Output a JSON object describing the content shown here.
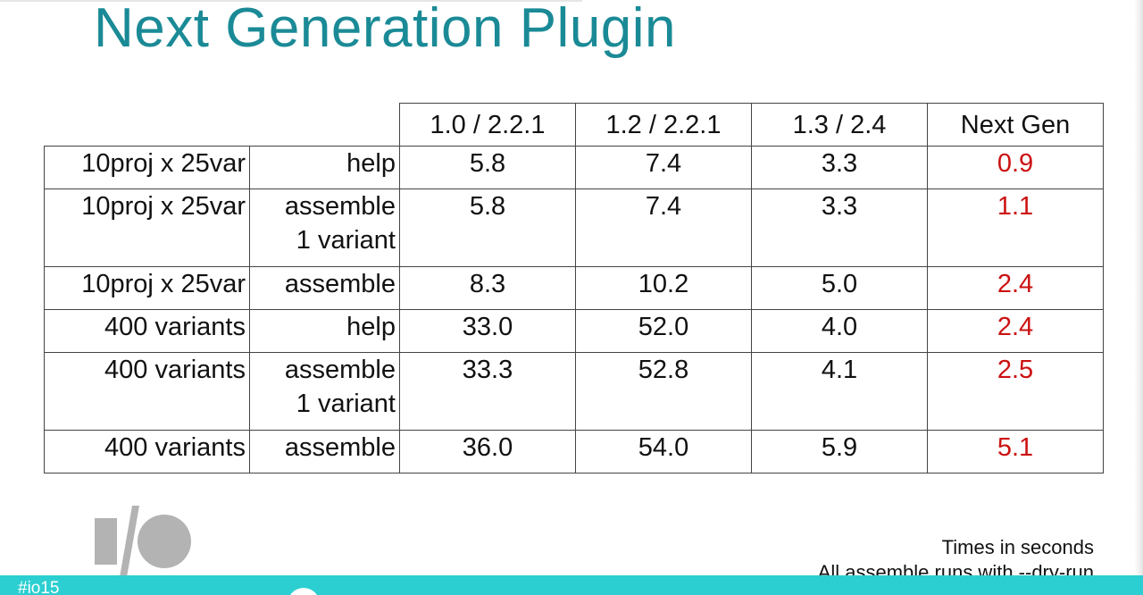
{
  "slide": {
    "title": "Next Generation Plugin",
    "hashtag": "#io15"
  },
  "table": {
    "headers": [
      "1.0 / 2.2.1",
      "1.2 / 2.2.1",
      "1.3 / 2.4",
      "Next Gen"
    ],
    "rows": [
      {
        "project": "10proj x 25var",
        "task": "help",
        "task2": "",
        "values": [
          "5.8",
          "7.4",
          "3.3",
          "0.9"
        ]
      },
      {
        "project": "10proj x 25var",
        "task": "assemble",
        "task2": "1 variant",
        "values": [
          "5.8",
          "7.4",
          "3.3",
          "1.1"
        ]
      },
      {
        "project": "10proj x 25var",
        "task": "assemble",
        "task2": "",
        "values": [
          "8.3",
          "10.2",
          "5.0",
          "2.4"
        ]
      },
      {
        "project": "400 variants",
        "task": "help",
        "task2": "",
        "values": [
          "33.0",
          "52.0",
          "4.0",
          "2.4"
        ]
      },
      {
        "project": "400 variants",
        "task": "assemble",
        "task2": "1 variant",
        "values": [
          "33.3",
          "52.8",
          "4.1",
          "2.5"
        ]
      },
      {
        "project": "400 variants",
        "task": "assemble",
        "task2": "",
        "values": [
          "36.0",
          "54.0",
          "5.9",
          "5.1"
        ]
      }
    ]
  },
  "notes": {
    "line1": "Times in seconds",
    "line2": "All assemble runs with --dry-run"
  },
  "colors": {
    "title": "#1a8a96",
    "next_gen_values": "#cc1111",
    "footer_bar": "#2ccfd1"
  },
  "icons": {
    "logo": "google-io-logo-icon"
  }
}
